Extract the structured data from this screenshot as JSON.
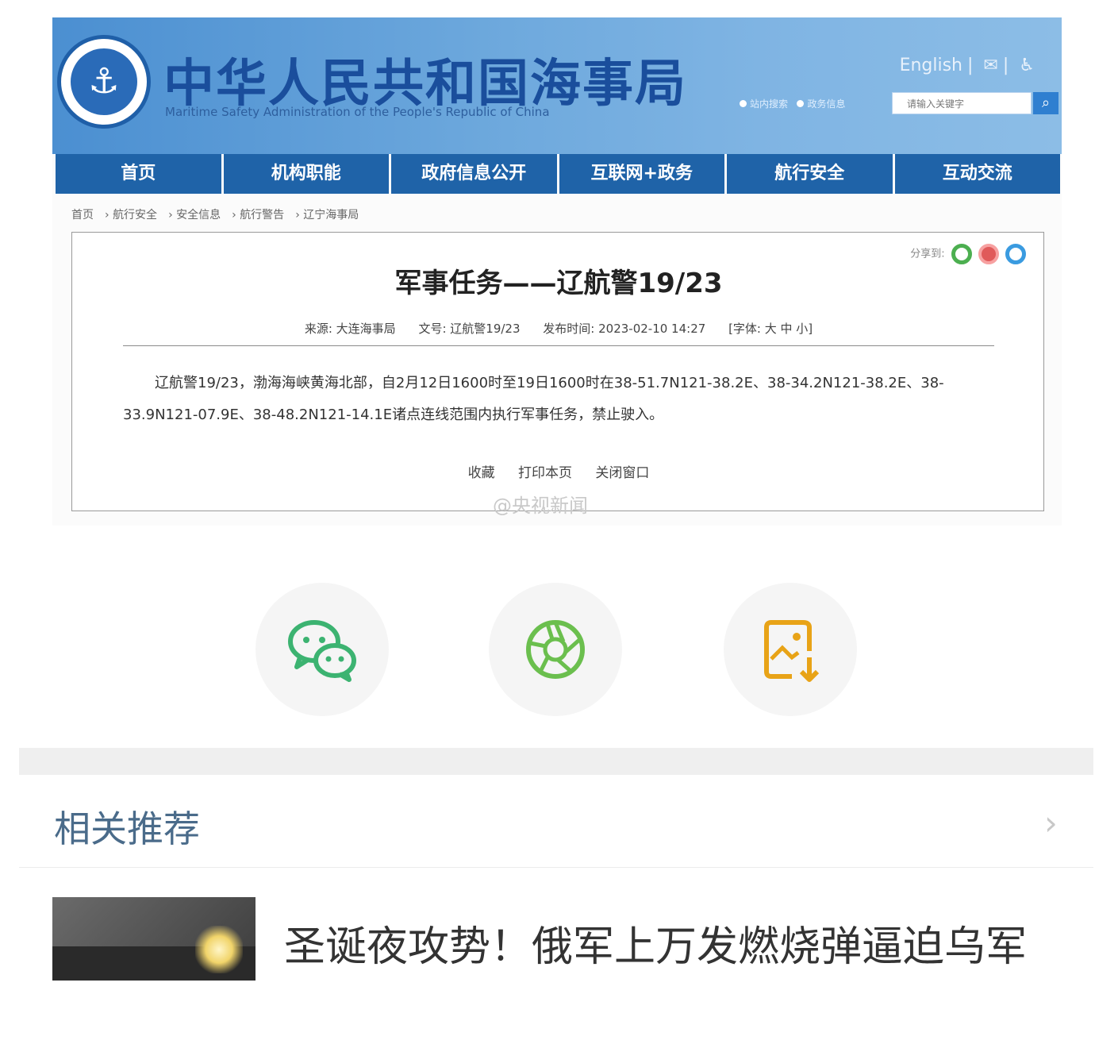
{
  "site": {
    "title": "中华人民共和国海事局",
    "subtitle": "Maritime Safety Administration of the People's Republic of China",
    "top_links": [
      "English",
      "✉",
      "♿"
    ],
    "radios": [
      "站内搜索",
      "政务信息"
    ],
    "search_placeholder": "请输入关键字"
  },
  "nav": [
    "首页",
    "机构职能",
    "政府信息公开",
    "互联网+政务",
    "航行安全",
    "互动交流"
  ],
  "breadcrumb": [
    "首页",
    "航行安全",
    "安全信息",
    "航行警告",
    "辽宁海事局"
  ],
  "article": {
    "share_label": "分享到:",
    "title": "军事任务——辽航警19/23",
    "meta": {
      "source": "来源: 大连海事局",
      "doc_no": "文号: 辽航警19/23",
      "published": "发布时间: 2023-02-10 14:27",
      "font_size": "[字体: 大 中 小]"
    },
    "body": "辽航警19/23，渤海海峡黄海北部，自2月12日1600时至19日1600时在38-51.7N121-38.2E、38-34.2N121-38.2E、38-33.9N121-07.9E、38-48.2N121-14.1E诸点连线范围内执行军事任务，禁止驶入。",
    "actions": [
      "收藏",
      "打印本页",
      "关闭窗口"
    ],
    "watermark": "@央视新闻"
  },
  "share_buttons": [
    {
      "icon": "wechat-icon",
      "color": "#3cb371"
    },
    {
      "icon": "moments-icon",
      "color": "#6bbf4e"
    },
    {
      "icon": "save-image-icon",
      "color": "#e8a317"
    }
  ],
  "recommend": {
    "title": "相关推荐",
    "arrow": "›",
    "news_title": "圣诞夜攻势！俄军上万发燃烧弹逼迫乌军"
  },
  "colors": {
    "banner": "#6ea9dd",
    "nav": "#1f63a8",
    "title_blue": "#1a4e9c"
  }
}
